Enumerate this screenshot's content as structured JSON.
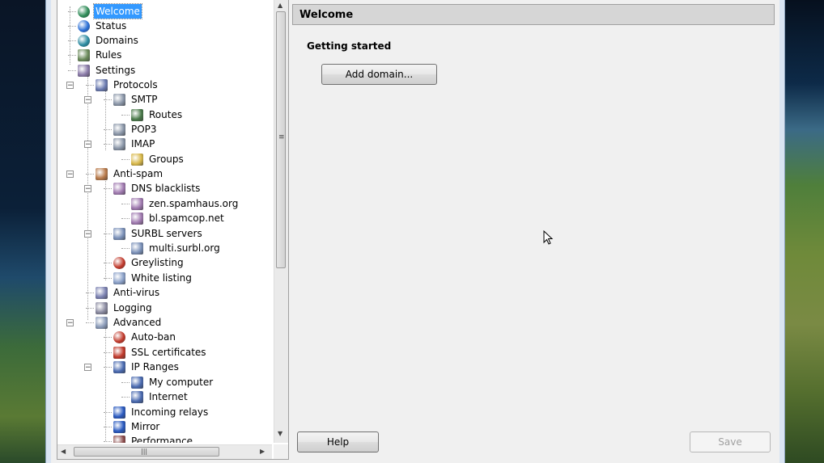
{
  "tree": {
    "items": [
      {
        "label": "Welcome",
        "icon": "globe-green-icon",
        "color": "#2e8b57",
        "selected": true
      },
      {
        "label": "Status",
        "icon": "info-icon",
        "color": "#2a6fd6"
      },
      {
        "label": "Domains",
        "icon": "globe-icon",
        "color": "#2a8aa0"
      },
      {
        "label": "Rules",
        "icon": "rules-icon",
        "color": "#6a8a5a"
      },
      {
        "label": "Settings",
        "icon": "settings-icon",
        "color": "#8a7aa8"
      },
      {
        "label": "Protocols",
        "icon": "protocols-icon",
        "color": "#6a7ab0"
      },
      {
        "label": "SMTP",
        "icon": "network-icon",
        "color": "#8a96a8"
      },
      {
        "label": "Routes",
        "icon": "routes-icon",
        "color": "#4a7a4a"
      },
      {
        "label": "POP3",
        "icon": "network-icon",
        "color": "#8a96a8"
      },
      {
        "label": "IMAP",
        "icon": "network-icon",
        "color": "#8a96a8"
      },
      {
        "label": "Groups",
        "icon": "folder-icon",
        "color": "#d8b84a"
      },
      {
        "label": "Anti-spam",
        "icon": "antispam-icon",
        "color": "#b87a4a"
      },
      {
        "label": "DNS blacklists",
        "icon": "blacklist-icon",
        "color": "#a07ab0"
      },
      {
        "label": "zen.spamhaus.org",
        "icon": "blacklist-item-icon",
        "color": "#a07ab0"
      },
      {
        "label": "bl.spamcop.net",
        "icon": "blacklist-item-icon",
        "color": "#a07ab0"
      },
      {
        "label": "SURBL servers",
        "icon": "surbl-icon",
        "color": "#7a90b8"
      },
      {
        "label": "multi.surbl.org",
        "icon": "surbl-item-icon",
        "color": "#7a90b8"
      },
      {
        "label": "Greylisting",
        "icon": "greylisting-icon",
        "color": "#c0392b"
      },
      {
        "label": "White listing",
        "icon": "whitelisting-icon",
        "color": "#8aa0c8"
      },
      {
        "label": "Anti-virus",
        "icon": "antivirus-icon",
        "color": "#7a80b0"
      },
      {
        "label": "Logging",
        "icon": "logging-icon",
        "color": "#8a8aa0"
      },
      {
        "label": "Advanced",
        "icon": "advanced-icon",
        "color": "#8a9ab8"
      },
      {
        "label": "Auto-ban",
        "icon": "autoban-icon",
        "color": "#c0392b"
      },
      {
        "label": "SSL certificates",
        "icon": "certificate-icon",
        "color": "#c0392b"
      },
      {
        "label": "IP Ranges",
        "icon": "ip-ranges-icon",
        "color": "#4a6ab0"
      },
      {
        "label": "My computer",
        "icon": "computer-icon",
        "color": "#4a6ab0"
      },
      {
        "label": "Internet",
        "icon": "internet-icon",
        "color": "#4a6ab0"
      },
      {
        "label": "Incoming relays",
        "icon": "relay-icon",
        "color": "#2a5ac0"
      },
      {
        "label": "Mirror",
        "icon": "mirror-icon",
        "color": "#2a5ac0"
      },
      {
        "label": "Performance",
        "icon": "performance-icon",
        "color": "#8a4a4a"
      }
    ]
  },
  "pane": {
    "title": "Welcome",
    "section": "Getting started",
    "add_domain_label": "Add domain..."
  },
  "footer": {
    "help_label": "Help",
    "save_label": "Save"
  },
  "scroll": {
    "arrow_up": "▲",
    "arrow_down": "▼",
    "arrow_left": "◀",
    "arrow_right": "▶",
    "grip_v": "≡",
    "grip_h": "|||"
  }
}
